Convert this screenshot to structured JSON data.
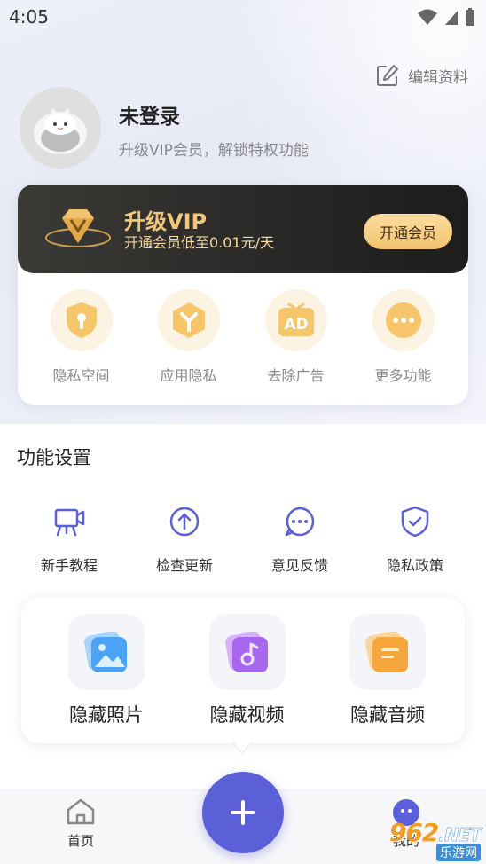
{
  "status_bar": {
    "time": "4:05"
  },
  "profile": {
    "edit_label": "编辑资料",
    "name": "未登录",
    "subtitle": "升级VIP会员，解锁特权功能"
  },
  "vip": {
    "title": "升级VIP",
    "subtitle": "开通会员低至0.01元/天",
    "button_label": "开通会员",
    "features": [
      {
        "label": "隐私空间",
        "icon": "shield-lock-icon"
      },
      {
        "label": "应用隐私",
        "icon": "app-privacy-icon"
      },
      {
        "label": "去除广告",
        "icon": "ad-icon",
        "icon_text": "AD"
      },
      {
        "label": "更多功能",
        "icon": "more-icon"
      }
    ]
  },
  "settings": {
    "title": "功能设置",
    "items": [
      {
        "label": "新手教程",
        "icon": "tutorial-icon"
      },
      {
        "label": "检查更新",
        "icon": "update-icon"
      },
      {
        "label": "意见反馈",
        "icon": "feedback-icon"
      },
      {
        "label": "隐私政策",
        "icon": "privacy-policy-icon"
      }
    ]
  },
  "hide_menu": {
    "items": [
      {
        "label": "隐藏照片",
        "icon": "photo-icon"
      },
      {
        "label": "隐藏视频",
        "icon": "video-icon"
      },
      {
        "label": "隐藏音频",
        "icon": "audio-icon"
      }
    ]
  },
  "bottom_nav": {
    "home_label": "首页",
    "mine_label": "我的",
    "fab_icon": "plus-icon"
  },
  "watermark": {
    "main": "962",
    "net": ".NET",
    "sub": "乐游网"
  },
  "colors": {
    "accent": "#5b5fd8",
    "vip_gold": "#f3c779",
    "vip_dark": "#2b2a28",
    "feature_bg": "#fdf3e3"
  }
}
